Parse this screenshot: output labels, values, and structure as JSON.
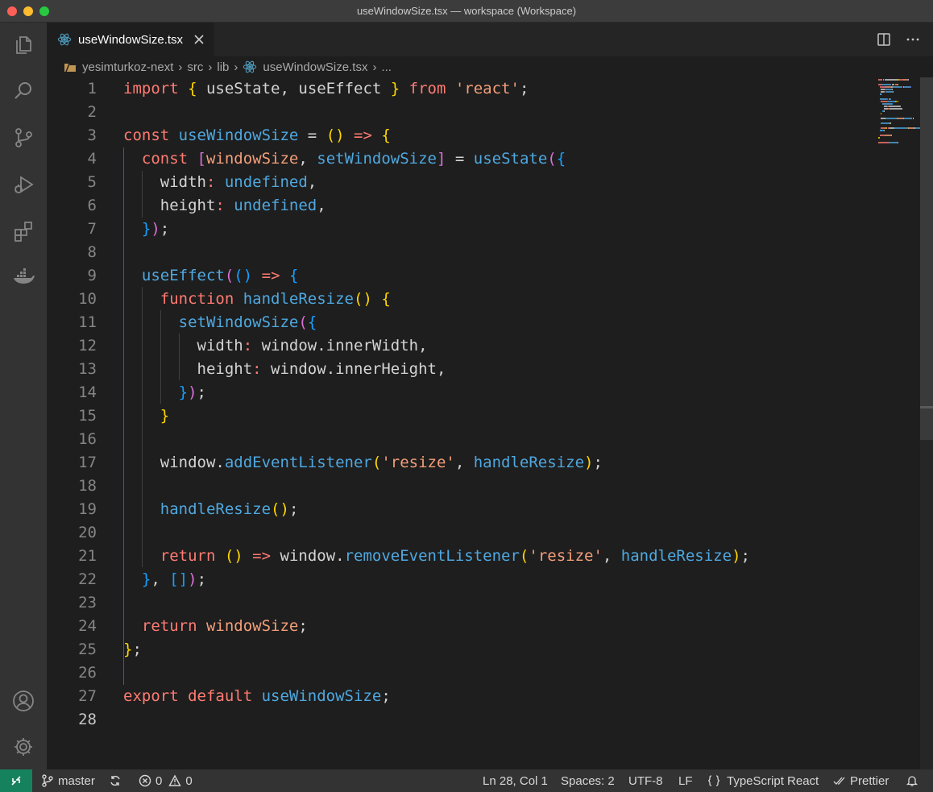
{
  "window": {
    "title": "useWindowSize.tsx — workspace (Workspace)"
  },
  "colors": {
    "accent_remote": "#16825d",
    "keyword": "#ff7b72",
    "function": "#4fa8e0",
    "string": "#f49e7a",
    "bracket_gold": "#ffd700",
    "bracket_purple": "#da70d6",
    "bracket_blue": "#179fff"
  },
  "activity_bar": {
    "items": [
      {
        "name": "explorer",
        "icon": "files-icon"
      },
      {
        "name": "search",
        "icon": "search-icon"
      },
      {
        "name": "source-control",
        "icon": "source-control-icon"
      },
      {
        "name": "run-debug",
        "icon": "run-debug-icon"
      },
      {
        "name": "extensions",
        "icon": "extensions-icon"
      },
      {
        "name": "docker",
        "icon": "docker-icon"
      }
    ],
    "bottom": [
      {
        "name": "accounts",
        "icon": "account-icon"
      },
      {
        "name": "manage",
        "icon": "gear-icon"
      }
    ]
  },
  "tab": {
    "label": "useWindowSize.tsx",
    "icon": "react-icon"
  },
  "breadcrumb": {
    "items": [
      "yesimturkoz-next",
      "src",
      "lib",
      "useWindowSize.tsx",
      "..."
    ]
  },
  "editor": {
    "active_line": 28,
    "lines": [
      {
        "n": "1",
        "tokens": [
          {
            "t": "import",
            "c": "#ff7b72"
          },
          {
            "t": " ",
            "c": "#d4d4d4"
          },
          {
            "t": "{",
            "c": "#ffd700"
          },
          {
            "t": " useState, useEffect ",
            "c": "#d4d4d4"
          },
          {
            "t": "}",
            "c": "#ffd700"
          },
          {
            "t": " from ",
            "c": "#ff7b72"
          },
          {
            "t": "'react'",
            "c": "#f49e7a"
          },
          {
            "t": ";",
            "c": "#d4d4d4"
          }
        ]
      },
      {
        "n": "2",
        "tokens": []
      },
      {
        "n": "3",
        "tokens": [
          {
            "t": "const ",
            "c": "#ff7b72"
          },
          {
            "t": "useWindowSize",
            "c": "#4fa8e0"
          },
          {
            "t": " = ",
            "c": "#d4d4d4"
          },
          {
            "t": "()",
            "c": "#ffd700"
          },
          {
            "t": " => ",
            "c": "#ff7b72"
          },
          {
            "t": "{",
            "c": "#ffd700"
          }
        ]
      },
      {
        "n": "4",
        "tokens": [
          {
            "t": "  ",
            "c": "#d4d4d4"
          },
          {
            "t": "const ",
            "c": "#ff7b72"
          },
          {
            "t": "[",
            "c": "#da70d6"
          },
          {
            "t": "windowSize",
            "c": "#f49e7a"
          },
          {
            "t": ", ",
            "c": "#d4d4d4"
          },
          {
            "t": "setWindowSize",
            "c": "#4fa8e0"
          },
          {
            "t": "]",
            "c": "#da70d6"
          },
          {
            "t": " = ",
            "c": "#d4d4d4"
          },
          {
            "t": "useState",
            "c": "#4fa8e0"
          },
          {
            "t": "(",
            "c": "#da70d6"
          },
          {
            "t": "{",
            "c": "#179fff"
          }
        ]
      },
      {
        "n": "5",
        "tokens": [
          {
            "t": "    width",
            "c": "#d4d4d4"
          },
          {
            "t": ": ",
            "c": "#ff7b72"
          },
          {
            "t": "undefined",
            "c": "#4fa8e0"
          },
          {
            "t": ",",
            "c": "#d4d4d4"
          }
        ]
      },
      {
        "n": "6",
        "tokens": [
          {
            "t": "    height",
            "c": "#d4d4d4"
          },
          {
            "t": ": ",
            "c": "#ff7b72"
          },
          {
            "t": "undefined",
            "c": "#4fa8e0"
          },
          {
            "t": ",",
            "c": "#d4d4d4"
          }
        ]
      },
      {
        "n": "7",
        "tokens": [
          {
            "t": "  ",
            "c": "#d4d4d4"
          },
          {
            "t": "}",
            "c": "#179fff"
          },
          {
            "t": ")",
            "c": "#da70d6"
          },
          {
            "t": ";",
            "c": "#d4d4d4"
          }
        ]
      },
      {
        "n": "8",
        "tokens": []
      },
      {
        "n": "9",
        "tokens": [
          {
            "t": "  ",
            "c": "#d4d4d4"
          },
          {
            "t": "useEffect",
            "c": "#4fa8e0"
          },
          {
            "t": "(",
            "c": "#da70d6"
          },
          {
            "t": "()",
            "c": "#179fff"
          },
          {
            "t": " => ",
            "c": "#ff7b72"
          },
          {
            "t": "{",
            "c": "#179fff"
          }
        ]
      },
      {
        "n": "10",
        "tokens": [
          {
            "t": "    ",
            "c": "#d4d4d4"
          },
          {
            "t": "function ",
            "c": "#ff7b72"
          },
          {
            "t": "handleResize",
            "c": "#4fa8e0"
          },
          {
            "t": "()",
            "c": "#ffd700"
          },
          {
            "t": " ",
            "c": "#d4d4d4"
          },
          {
            "t": "{",
            "c": "#ffd700"
          }
        ]
      },
      {
        "n": "11",
        "tokens": [
          {
            "t": "      ",
            "c": "#d4d4d4"
          },
          {
            "t": "setWindowSize",
            "c": "#4fa8e0"
          },
          {
            "t": "(",
            "c": "#da70d6"
          },
          {
            "t": "{",
            "c": "#179fff"
          }
        ]
      },
      {
        "n": "12",
        "tokens": [
          {
            "t": "        width",
            "c": "#d4d4d4"
          },
          {
            "t": ": ",
            "c": "#ff7b72"
          },
          {
            "t": "window",
            "c": "#d4d4d4"
          },
          {
            "t": ".",
            "c": "#d4d4d4"
          },
          {
            "t": "innerWidth",
            "c": "#d4d4d4"
          },
          {
            "t": ",",
            "c": "#d4d4d4"
          }
        ]
      },
      {
        "n": "13",
        "tokens": [
          {
            "t": "        height",
            "c": "#d4d4d4"
          },
          {
            "t": ": ",
            "c": "#ff7b72"
          },
          {
            "t": "window",
            "c": "#d4d4d4"
          },
          {
            "t": ".",
            "c": "#d4d4d4"
          },
          {
            "t": "innerHeight",
            "c": "#d4d4d4"
          },
          {
            "t": ",",
            "c": "#d4d4d4"
          }
        ]
      },
      {
        "n": "14",
        "tokens": [
          {
            "t": "      ",
            "c": "#d4d4d4"
          },
          {
            "t": "}",
            "c": "#179fff"
          },
          {
            "t": ")",
            "c": "#da70d6"
          },
          {
            "t": ";",
            "c": "#d4d4d4"
          }
        ]
      },
      {
        "n": "15",
        "tokens": [
          {
            "t": "    ",
            "c": "#d4d4d4"
          },
          {
            "t": "}",
            "c": "#ffd700"
          }
        ]
      },
      {
        "n": "16",
        "tokens": []
      },
      {
        "n": "17",
        "tokens": [
          {
            "t": "    window.",
            "c": "#d4d4d4"
          },
          {
            "t": "addEventListener",
            "c": "#4fa8e0"
          },
          {
            "t": "(",
            "c": "#ffd700"
          },
          {
            "t": "'resize'",
            "c": "#f49e7a"
          },
          {
            "t": ", ",
            "c": "#d4d4d4"
          },
          {
            "t": "handleResize",
            "c": "#4fa8e0"
          },
          {
            "t": ")",
            "c": "#ffd700"
          },
          {
            "t": ";",
            "c": "#d4d4d4"
          }
        ]
      },
      {
        "n": "18",
        "tokens": []
      },
      {
        "n": "19",
        "tokens": [
          {
            "t": "    ",
            "c": "#d4d4d4"
          },
          {
            "t": "handleResize",
            "c": "#4fa8e0"
          },
          {
            "t": "()",
            "c": "#ffd700"
          },
          {
            "t": ";",
            "c": "#d4d4d4"
          }
        ]
      },
      {
        "n": "20",
        "tokens": []
      },
      {
        "n": "21",
        "tokens": [
          {
            "t": "    ",
            "c": "#d4d4d4"
          },
          {
            "t": "return ",
            "c": "#ff7b72"
          },
          {
            "t": "()",
            "c": "#ffd700"
          },
          {
            "t": " => ",
            "c": "#ff7b72"
          },
          {
            "t": "window.",
            "c": "#d4d4d4"
          },
          {
            "t": "removeEventListener",
            "c": "#4fa8e0"
          },
          {
            "t": "(",
            "c": "#ffd700"
          },
          {
            "t": "'resize'",
            "c": "#f49e7a"
          },
          {
            "t": ", ",
            "c": "#d4d4d4"
          },
          {
            "t": "handleResize",
            "c": "#4fa8e0"
          },
          {
            "t": ")",
            "c": "#ffd700"
          },
          {
            "t": ";",
            "c": "#d4d4d4"
          }
        ]
      },
      {
        "n": "22",
        "tokens": [
          {
            "t": "  ",
            "c": "#d4d4d4"
          },
          {
            "t": "}",
            "c": "#179fff"
          },
          {
            "t": ", ",
            "c": "#d4d4d4"
          },
          {
            "t": "[]",
            "c": "#179fff"
          },
          {
            "t": ")",
            "c": "#da70d6"
          },
          {
            "t": ";",
            "c": "#d4d4d4"
          }
        ]
      },
      {
        "n": "23",
        "tokens": []
      },
      {
        "n": "24",
        "tokens": [
          {
            "t": "  ",
            "c": "#d4d4d4"
          },
          {
            "t": "return ",
            "c": "#ff7b72"
          },
          {
            "t": "windowSize",
            "c": "#f49e7a"
          },
          {
            "t": ";",
            "c": "#d4d4d4"
          }
        ]
      },
      {
        "n": "25",
        "tokens": [
          {
            "t": "}",
            "c": "#ffd700"
          },
          {
            "t": ";",
            "c": "#d4d4d4"
          }
        ]
      },
      {
        "n": "26",
        "tokens": []
      },
      {
        "n": "27",
        "tokens": [
          {
            "t": "export default ",
            "c": "#ff7b72"
          },
          {
            "t": "useWindowSize",
            "c": "#4fa8e0"
          },
          {
            "t": ";",
            "c": "#d4d4d4"
          }
        ]
      },
      {
        "n": "28",
        "tokens": []
      }
    ]
  },
  "statusbar": {
    "branch": "master",
    "errors": "0",
    "warnings": "0",
    "position": "Ln 28, Col 1",
    "spaces": "Spaces: 2",
    "encoding": "UTF-8",
    "eol": "LF",
    "language": "TypeScript React",
    "formatter": "Prettier"
  }
}
